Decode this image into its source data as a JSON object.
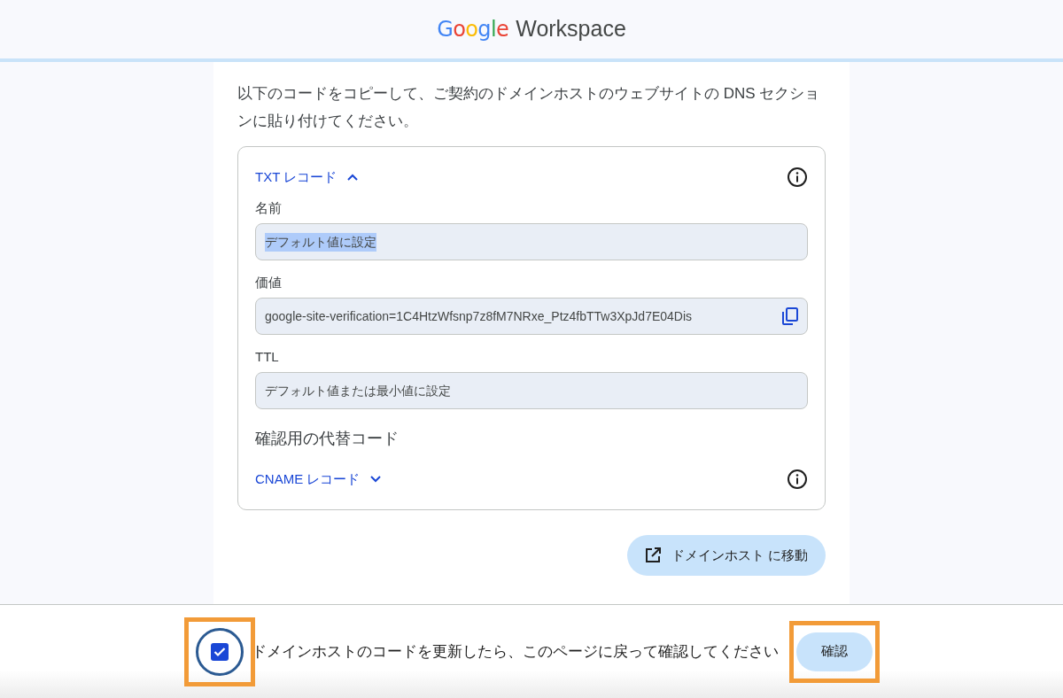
{
  "header": {
    "logo_google": "Google",
    "logo_product": "Workspace"
  },
  "instructions": "以下のコードをコピーして、ご契約のドメインホストのウェブサイトの DNS セクションに貼り付けてください。",
  "records": [
    {
      "title": "TXT レコード",
      "expanded": true,
      "fields": [
        {
          "label": "名前",
          "value": "デフォルト値に設定",
          "text_selected": true,
          "copyable": false
        },
        {
          "label": "価値",
          "value": "google-site-verification=1C4HtzWfsnp7z8fM7NRxe_Ptz4fbTTw3XpJd7E04Dis",
          "text_selected": false,
          "copyable": true
        },
        {
          "label": "TTL",
          "value": "デフォルト値または最小値に設定",
          "text_selected": false,
          "copyable": false
        }
      ]
    }
  ],
  "alternate_heading": "確認用の代替コード",
  "alternate_records": [
    {
      "title": "CNAME レコード",
      "expanded": false
    }
  ],
  "go_button": "ドメインホスト に移動",
  "footer": {
    "checkbox_checked": true,
    "checkbox_highlighted": true,
    "message": "ドメインホストのコードを更新したら、このページに戻って確認してください",
    "confirm_button": "確認",
    "confirm_highlighted": true
  }
}
